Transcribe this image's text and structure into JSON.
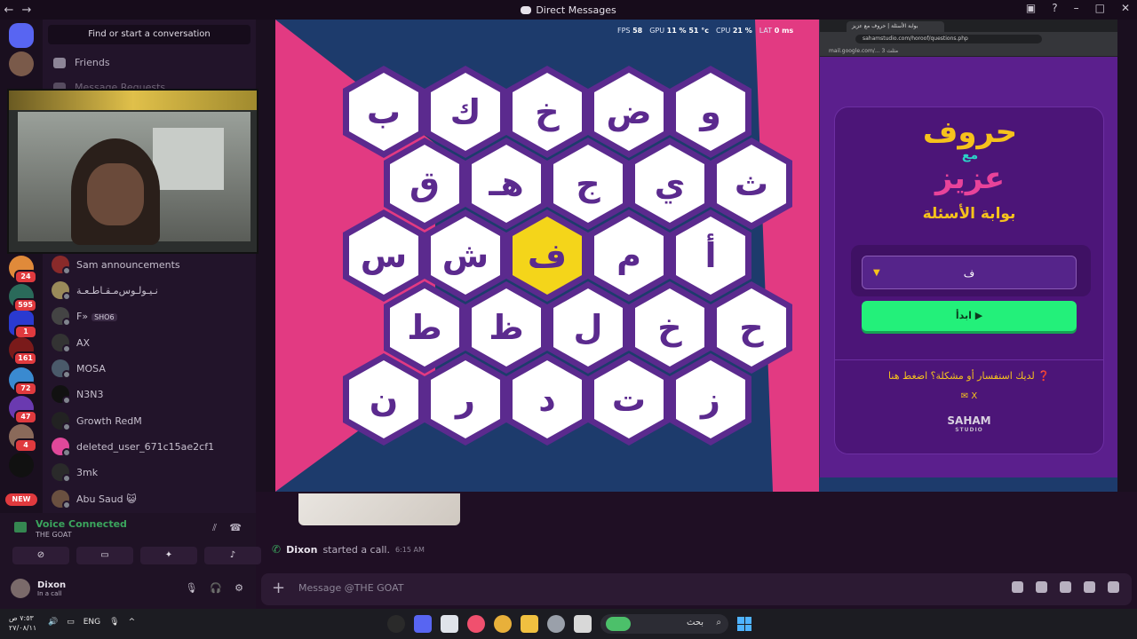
{
  "window": {
    "title": "Direct Messages"
  },
  "dm_panel": {
    "search_label": "Find or start a conversation",
    "friends_label": "Friends",
    "message_requests_label": "Message Requests",
    "items": [
      {
        "name": "Sam announcements",
        "color": "#8a2a2a"
      },
      {
        "name": "مـقـاطـعـة‎نـيـولـوس",
        "color": "#9a8a5a"
      },
      {
        "name": "F»",
        "tag": "SHO6",
        "color": "#444"
      },
      {
        "name": "AX",
        "color": "#333"
      },
      {
        "name": "MOSA",
        "color": "#4a5a6a"
      },
      {
        "name": "N3N3",
        "color": "#111"
      },
      {
        "name": "Growth RedM",
        "color": "#222"
      },
      {
        "name": "deleted_user_671c15ae2cf1",
        "color": "#e0489a"
      },
      {
        "name": "3mk",
        "color": "#2a2a2a"
      },
      {
        "name": "Abu Saud 😺",
        "color": "#6a5040"
      }
    ]
  },
  "server_badges": [
    "24",
    "595",
    "1",
    "161",
    "72",
    "47",
    "4"
  ],
  "new_badge": "NEW",
  "stream": {
    "hud": {
      "fps_label": "FPS",
      "fps": "58",
      "gpu_label": "GPU",
      "gpu": "11 % 51 °c",
      "cpu_label": "CPU",
      "cpu": "21 %",
      "lat_label": "LAT",
      "lat": "0 ms"
    },
    "board_rows": [
      [
        "ب",
        "ك",
        "خ",
        "ض",
        "و"
      ],
      [
        "ق",
        "هـ",
        "ج",
        "ي",
        "ث"
      ],
      [
        "س",
        "ش",
        "ف",
        "م",
        "أ"
      ],
      [
        "ط",
        "ظ",
        "ل",
        "خ",
        "ح"
      ],
      [
        "ن",
        "ر",
        "د",
        "ت",
        "ز"
      ]
    ],
    "selected": "ف"
  },
  "browser": {
    "tab_title": "بوابة الأسئلة | حروف مع عزيز",
    "url": "sahamstudio.com/horoof/questions.php",
    "bookmarks": "mail.google.com/...    مثلث 3",
    "logo": {
      "line1": "حروف",
      "line2": "مع",
      "line3": "عزيز"
    },
    "heading": "بوابة الأسئلة",
    "select_value": "ف",
    "go_label": "ابدأ ▶",
    "help_text": "لديك استفسار أو مشكلة؟ اضغط هنا ❓",
    "social": "✉ X",
    "brand": "SAHAM",
    "brand_sub": "STUDIO"
  },
  "messages": {
    "call_user": "Dixon",
    "call_text": "started a call.",
    "call_time": "6:15 AM",
    "composer_placeholder": "Message @THE GOAT"
  },
  "voice": {
    "status": "Voice Connected",
    "channel": "THE GOAT",
    "user_name": "Dixon",
    "user_status": "In a call"
  },
  "taskbar": {
    "time": "٧:٥٣ ص",
    "date": "٢٧/٠٨/١١",
    "lang": "ENG",
    "search_text": "بحث"
  }
}
